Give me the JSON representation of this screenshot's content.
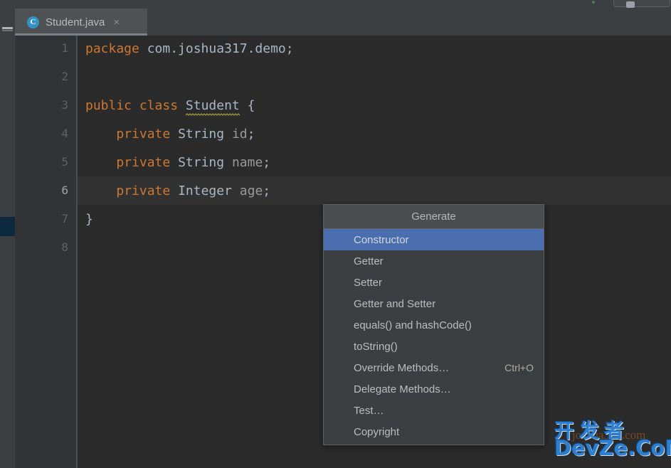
{
  "window": {
    "background_color": "#2b2b2b",
    "toolbar_color": "#3c3f41"
  },
  "tab": {
    "icon": "java-class-icon",
    "icon_glyph": "C",
    "label": "Student.java",
    "close_glyph": "×",
    "active": true
  },
  "left_strip": {
    "hide_tool_window_icon": "minus-icon",
    "marker_name": "error-stripe-marker",
    "marker_color": "#0d293e"
  },
  "gutter": {
    "line_numbers": [
      "1",
      "2",
      "3",
      "4",
      "5",
      "6",
      "7",
      "8"
    ],
    "current_line": 6
  },
  "editor": {
    "current_line_highlight": 6,
    "lines": [
      {
        "n": 1,
        "tokens": [
          {
            "t": "package",
            "c": "kw"
          },
          {
            "t": " ",
            "c": "punct"
          },
          {
            "t": "com.joshua317.demo",
            "c": "ident"
          },
          {
            "t": ";",
            "c": "punct"
          }
        ]
      },
      {
        "n": 2,
        "tokens": []
      },
      {
        "n": 3,
        "tokens": [
          {
            "t": "public",
            "c": "kw"
          },
          {
            "t": " ",
            "c": "punct"
          },
          {
            "t": "class",
            "c": "kw"
          },
          {
            "t": " ",
            "c": "punct"
          },
          {
            "t": "Student",
            "c": "classname",
            "warning": true
          },
          {
            "t": " {",
            "c": "punct"
          }
        ]
      },
      {
        "n": 4,
        "tokens": [
          {
            "t": "    ",
            "c": "punct"
          },
          {
            "t": "private",
            "c": "kw"
          },
          {
            "t": " ",
            "c": "punct"
          },
          {
            "t": "String",
            "c": "ident"
          },
          {
            "t": " ",
            "c": "punct"
          },
          {
            "t": "id",
            "c": "fieldname"
          },
          {
            "t": ";",
            "c": "punct"
          }
        ]
      },
      {
        "n": 5,
        "tokens": [
          {
            "t": "    ",
            "c": "punct"
          },
          {
            "t": "private",
            "c": "kw"
          },
          {
            "t": " ",
            "c": "punct"
          },
          {
            "t": "String",
            "c": "ident"
          },
          {
            "t": " ",
            "c": "punct"
          },
          {
            "t": "name",
            "c": "fieldname"
          },
          {
            "t": ";",
            "c": "punct"
          }
        ]
      },
      {
        "n": 6,
        "tokens": [
          {
            "t": "    ",
            "c": "punct"
          },
          {
            "t": "private",
            "c": "kw"
          },
          {
            "t": " ",
            "c": "punct"
          },
          {
            "t": "Integer",
            "c": "ident"
          },
          {
            "t": " ",
            "c": "punct"
          },
          {
            "t": "age",
            "c": "fieldname"
          },
          {
            "t": ";",
            "c": "punct"
          }
        ]
      },
      {
        "n": 7,
        "tokens": [
          {
            "t": "}",
            "c": "punct"
          }
        ]
      },
      {
        "n": 8,
        "tokens": []
      }
    ],
    "colors": {
      "keyword": "#cc7832",
      "identifier": "#a9b7c6",
      "field": "#9a9a9a",
      "warning_squiggle": "#a0a03c",
      "background": "#2b2b2b",
      "current_line": "#323232"
    }
  },
  "popup": {
    "title": "Generate",
    "selected_index": 0,
    "accent_color": "#4b6eaf",
    "items": [
      {
        "label": "Constructor",
        "shortcut": ""
      },
      {
        "label": "Getter",
        "shortcut": ""
      },
      {
        "label": "Setter",
        "shortcut": ""
      },
      {
        "label": "Getter and Setter",
        "shortcut": ""
      },
      {
        "label": "equals() and hashCode()",
        "shortcut": ""
      },
      {
        "label": "toString()",
        "shortcut": ""
      },
      {
        "label": "Override Methods…",
        "shortcut": "Ctrl+O"
      },
      {
        "label": "Delegate Methods…",
        "shortcut": ""
      },
      {
        "label": "Test…",
        "shortcut": ""
      },
      {
        "label": "Copyright",
        "shortcut": ""
      }
    ]
  },
  "watermarks": {
    "orange_text": "joshua317.com",
    "blue_cn_text": "开发者",
    "blue_en_text": "DevZe.CoM",
    "blue_color": "#2f7fd0"
  }
}
